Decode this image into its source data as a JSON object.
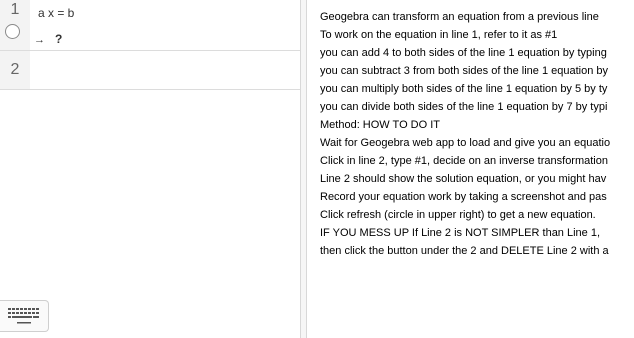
{
  "algebra": {
    "rows": [
      {
        "number": "1",
        "equation": "a x = b",
        "arrow": "→",
        "output": "?"
      },
      {
        "number": "2"
      }
    ],
    "keyboard_icon": "keyboard-icon",
    "visibility_icon": "circle-outline-icon"
  },
  "text_panel": {
    "lines": [
      "Geogebra can transform an equation from a previous line",
      "To work on the equation in line 1, refer to it as #1",
      "you can add 4 to both sides of the line 1 equation by typing",
      "you can subtract 3 from both sides of the line 1 equation by",
      "you can multiply both sides of the line 1 equation by 5 by ty",
      "you can divide both sides of the line 1 equation by 7 by typi",
      "Method: HOW TO DO IT",
      "Wait for Geogebra web app to load and give you an equatio",
      "Click in line 2, type #1, decide on an inverse transformation",
      "Line 2 should show the solution equation, or you might hav",
      "Record your equation work by taking a screenshot and pas",
      "Click refresh (circle in upper right) to get a new equation.",
      "IF YOU MESS UP If Line 2 is NOT SIMPLER than Line 1,",
      "then click the button under the 2 and DELETE Line 2 with a"
    ]
  }
}
